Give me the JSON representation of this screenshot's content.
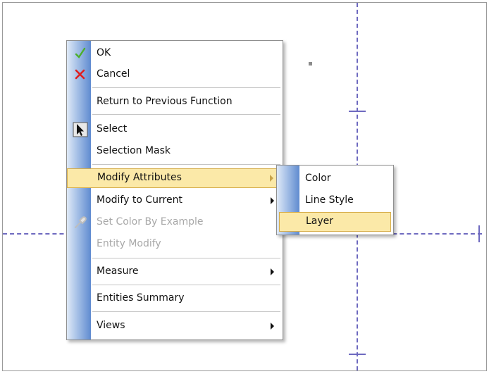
{
  "canvas": {
    "axis_color": "#6e6ac0",
    "background": "#ffffff"
  },
  "context_menu": {
    "items": [
      {
        "label": "OK",
        "icon": "check-icon",
        "enabled": true
      },
      {
        "label": "Cancel",
        "icon": "x-icon",
        "enabled": true
      },
      {
        "label": "Return to Previous Function",
        "enabled": true
      },
      {
        "label": "Select",
        "icon": "cursor-arrow-icon",
        "enabled": true
      },
      {
        "label": "Selection Mask",
        "enabled": true
      },
      {
        "label": "Modify Attributes",
        "enabled": true,
        "highlighted": true,
        "submenu": true
      },
      {
        "label": "Modify to Current",
        "enabled": true,
        "submenu": true
      },
      {
        "label": "Set Color By Example",
        "icon": "eyedropper-icon",
        "enabled": false
      },
      {
        "label": "Entity Modify",
        "enabled": false
      },
      {
        "label": "Measure",
        "enabled": true,
        "submenu": true
      },
      {
        "label": "Entities Summary",
        "enabled": true
      },
      {
        "label": "Views",
        "enabled": true,
        "submenu": true
      }
    ],
    "highlight_color": "#fbe9a8",
    "strip_color": "#5f8bd0"
  },
  "submenu": {
    "items": [
      {
        "label": "Color"
      },
      {
        "label": "Line Style"
      },
      {
        "label": "Layer",
        "highlighted": true
      }
    ]
  }
}
